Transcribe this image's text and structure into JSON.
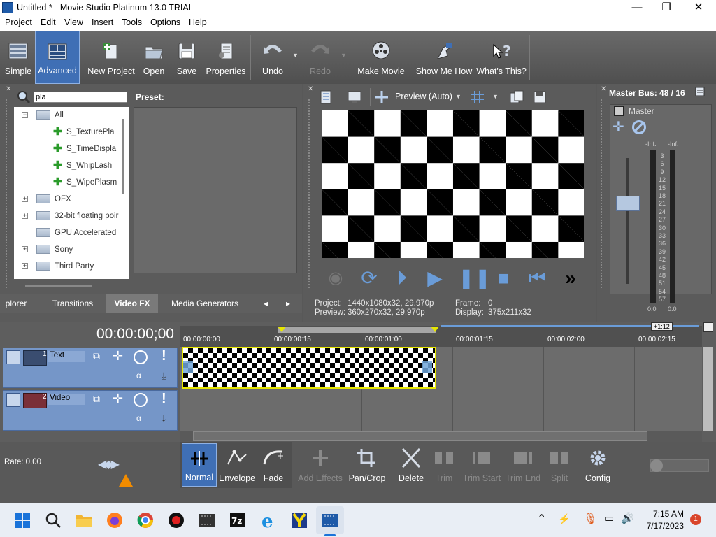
{
  "window": {
    "title": "Untitled * - Movie Studio Platinum 13.0 TRIAL",
    "minimize": "—",
    "maximize": "❐",
    "close": "✕"
  },
  "menu": [
    "Project",
    "Edit",
    "View",
    "Insert",
    "Tools",
    "Options",
    "Help"
  ],
  "toolbar": {
    "simple": "Simple",
    "advanced": "Advanced",
    "new_project": "New Project",
    "open": "Open",
    "save": "Save",
    "properties": "Properties",
    "undo": "Undo",
    "redo": "Redo",
    "make_movie": "Make Movie",
    "show_me_how": "Show Me How",
    "whats_this": "What's This?"
  },
  "explorer": {
    "search_value": "pla",
    "preset_label": "Preset:",
    "tree": [
      {
        "label": "All",
        "type": "folder",
        "expander": "−"
      },
      {
        "label": "S_TexturePla",
        "type": "fx"
      },
      {
        "label": "S_TimeDispla",
        "type": "fx"
      },
      {
        "label": "S_WhipLash",
        "type": "fx"
      },
      {
        "label": "S_WipePlasm",
        "type": "fx"
      },
      {
        "label": "OFX",
        "type": "folder",
        "expander": "+"
      },
      {
        "label": "32-bit floating poir",
        "type": "folder",
        "expander": "+"
      },
      {
        "label": "GPU Accelerated",
        "type": "folder",
        "expander": ""
      },
      {
        "label": "Sony",
        "type": "folder",
        "expander": "+"
      },
      {
        "label": "Third Party",
        "type": "folder",
        "expander": "+"
      }
    ],
    "tabs": [
      "plorer",
      "Transitions",
      "Video FX",
      "Media Generators"
    ],
    "active_tab": "Video FX",
    "tab_prev": "◂",
    "tab_next": "▸"
  },
  "preview": {
    "mode": "Preview (Auto)",
    "project_label": "Project:",
    "project_value": "1440x1080x32, 29.970p",
    "preview_label": "Preview:",
    "preview_value": "360x270x32, 29.970p",
    "frame_label": "Frame:",
    "frame_value": "0",
    "display_label": "Display:",
    "display_value": "375x211x32"
  },
  "master": {
    "title": "Master Bus: 48 / 16",
    "label": "Master",
    "inf_left": "-Inf.",
    "inf_right": "-Inf.",
    "scale": [
      "3",
      "6",
      "9",
      "12",
      "15",
      "18",
      "21",
      "24",
      "27",
      "30",
      "33",
      "36",
      "39",
      "42",
      "45",
      "48",
      "51",
      "54",
      "57"
    ],
    "bottom_left": "0.0",
    "bottom_right": "0.0"
  },
  "timeline": {
    "timecode": "00:00:00;00",
    "zoom_badge": "+1:12",
    "ruler": [
      "00:00:00:00",
      "00:00:00:15",
      "00:00:01:00",
      "00:00:01:15",
      "00:00:02:00",
      "00:00:02:15"
    ],
    "tracks": [
      {
        "number": "1",
        "name": "Text"
      },
      {
        "number": "2",
        "name": "Video"
      }
    ],
    "rate": "Rate: 0.00"
  },
  "edit_tools": {
    "normal": "Normal",
    "envelope": "Envelope",
    "fade": "Fade",
    "add_effects": "Add Effects",
    "pan_crop": "Pan/Crop",
    "delete": "Delete",
    "trim": "Trim",
    "trim_start": "Trim Start",
    "trim_end": "Trim End",
    "split": "Split",
    "config": "Config"
  },
  "taskbar": {
    "time": "7:15 AM",
    "date": "7/17/2023",
    "notification_count": "1"
  },
  "colors": {
    "accent": "#3f6fb5",
    "clip_border": "#e8e800",
    "track_header": "#7596c8"
  }
}
